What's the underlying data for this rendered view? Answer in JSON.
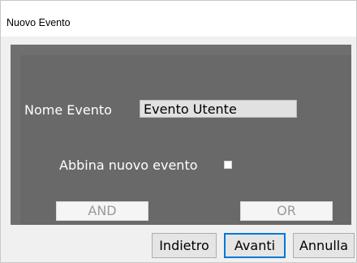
{
  "window": {
    "title": "Nuovo Evento"
  },
  "form": {
    "event_name_label": "Nome Evento",
    "event_name_value": "Evento Utente",
    "match_new_event_label": "Abbina nuovo evento",
    "match_new_event_checked": false
  },
  "logic_buttons": {
    "and_label": "AND",
    "or_label": "OR"
  },
  "footer": {
    "back_label": "Indietro",
    "next_label": "Avanti",
    "cancel_label": "Annulla"
  },
  "colors": {
    "panel_bg": "#696969",
    "focus_border": "#0078d7"
  }
}
